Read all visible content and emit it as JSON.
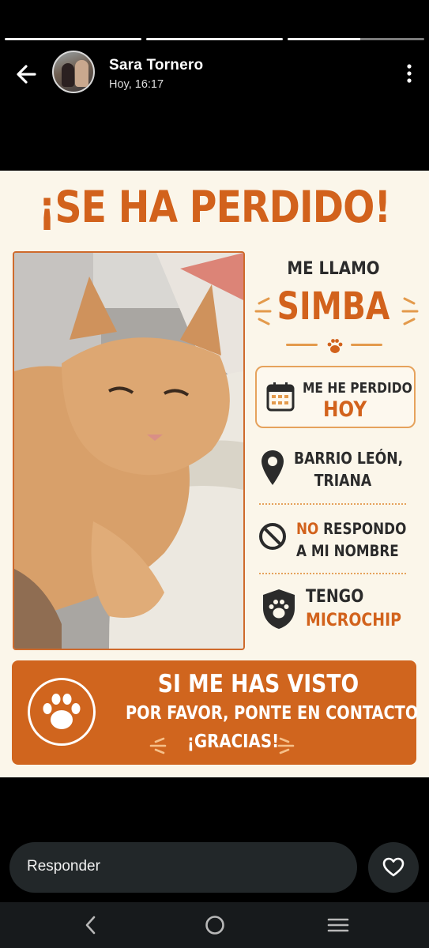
{
  "story": {
    "progress": [
      1,
      1,
      0.53
    ],
    "user_name": "Sara Tornero",
    "timestamp": "Hoy, 16:17"
  },
  "poster": {
    "title": "¡SE HA PERDIDO!",
    "intro": "ME LLAMO",
    "pet_name": "SIMBA",
    "lost_label": "ME HE PERDIDO",
    "lost_when": "HOY",
    "location_line1": "BARRIO LEÓN,",
    "location_line2": "TRIANA",
    "name_response_no": "NO",
    "name_response_rest": " RESPONDO",
    "name_response_line2": "A MI NOMBRE",
    "chip_line1": "TENGO",
    "chip_line2": "MICROCHIP",
    "banner_line1": "SI ME HAS VISTO",
    "banner_line2": "POR FAVOR, PONTE EN CONTACTO",
    "banner_line3": "¡GRACIAS!"
  },
  "reply": {
    "placeholder": "Responder"
  },
  "colors": {
    "accent": "#d2621c",
    "poster_bg": "#fbf6ea",
    "dark": "#2b2b2b"
  }
}
